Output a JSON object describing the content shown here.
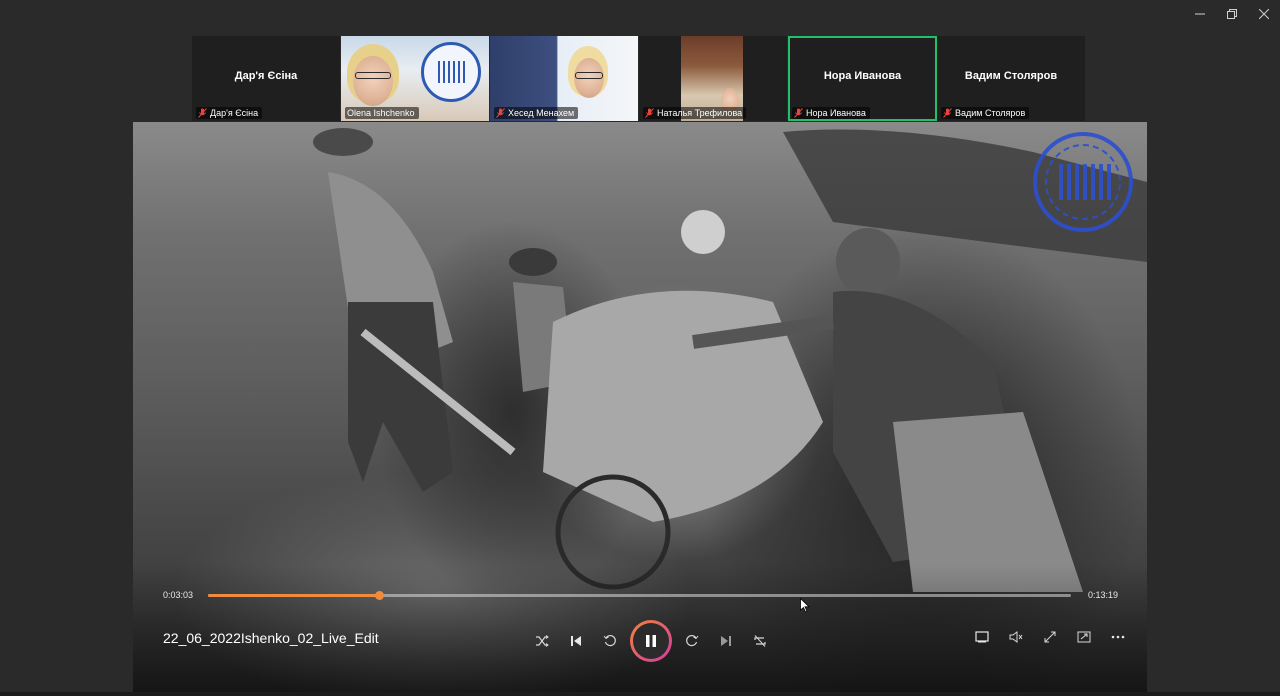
{
  "window": {
    "controls": [
      "minimize-icon",
      "restore-icon",
      "close-icon"
    ]
  },
  "participants": [
    {
      "center_name": "Дар'я Єсіна",
      "tag": "Дар'я Єсіна",
      "muted": true,
      "video": false
    },
    {
      "center_name": "",
      "tag": "Olena Ishchenko",
      "muted": false,
      "video": true
    },
    {
      "center_name": "",
      "tag": "Хесед Менахем",
      "muted": true,
      "video": true
    },
    {
      "center_name": "",
      "tag": "Наталья Трефилова",
      "muted": true,
      "video": true
    },
    {
      "center_name": "Нора Иванова",
      "tag": "Нора Иванова",
      "muted": true,
      "video": false,
      "active_speaker": true
    },
    {
      "center_name": "Вадим Столяров",
      "tag": "Вадим Столяров",
      "muted": true,
      "video": false
    }
  ],
  "player": {
    "title": "22_06_2022Ishenko_02_Live_Edit",
    "time_current": "0:03:03",
    "time_total": "0:13:19",
    "progress": 0.198,
    "state": "playing",
    "accent": "#f08a3c",
    "controls": [
      "shuffle-icon",
      "previous-icon",
      "rewind-10-icon",
      "pause-icon",
      "forward-30-icon",
      "next-icon",
      "repeat-off-icon"
    ],
    "right_controls": [
      "miniplayer-icon",
      "volume-icon",
      "fullscreen-icon",
      "cast-icon",
      "more-icon"
    ]
  },
  "colors": {
    "active_speaker_border": "#23c06b",
    "background": "#2a2a2a"
  }
}
